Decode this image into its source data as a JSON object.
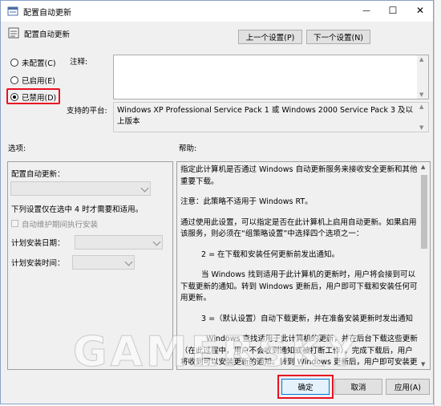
{
  "window": {
    "title": "配置自动更新",
    "header_label": "配置自动更新",
    "colors": {
      "accent": "#e81123",
      "titlebar_bg": "#ffffff",
      "dialog_bg": "#f0f0f0"
    }
  },
  "titlebar": {
    "minimize": "—",
    "maximize": "☐",
    "close": "✕"
  },
  "nav": {
    "prev_setting": "上一个设置(P)",
    "next_setting": "下一个设置(N)"
  },
  "state": {
    "options": [
      {
        "label": "未配置(C)",
        "selected": false
      },
      {
        "label": "已启用(E)",
        "selected": false
      },
      {
        "label": "已禁用(D)",
        "selected": true
      }
    ]
  },
  "comment": {
    "label": "注释:",
    "value": ""
  },
  "platform": {
    "label": "支持的平台:",
    "value": "Windows XP Professional Service Pack 1 或 Windows 2000 Service Pack 3 及以上版本"
  },
  "options_panel": {
    "label": "选项:",
    "configure_label": "配置自动更新：",
    "note": "下列设置仅在选中 4 时才需要和适用。",
    "maintenance_checkbox": "自动维护期间执行安装",
    "install_day_label": "计划安装日期：",
    "install_time_label": "计划安装时间："
  },
  "help_panel": {
    "label": "帮助:",
    "paragraphs": [
      "指定此计算机是否通过 Windows 自动更新服务来接收安全更新和其他重要下载。",
      "注意：此策略不适用于 Windows RT。",
      "通过使用此设置，可以指定是否在此计算机上启用自动更新。如果启用该服务，则必须在“组策略设置”中选择四个选项之一：",
      "2 = 在下载和安装任何更新前发出通知。",
      "当 Windows 找到适用于此计算机的更新时，用户将会接到可以下载更新的通知。转到 Windows 更新后，用户即可下载和安装任何可用更新。",
      "3 =（默认设置）自动下载更新，并在准备安装更新时发出通知",
      "Windows 查找适用于此计算机的更新，并在后台下载这些更新（在此过程中，用户不会收到通知或被打断工作）。完成下载后，用户将收到可以安装更新的通知。转到 Windows 更新后，用户即可安装更新。"
    ]
  },
  "footer": {
    "ok": "确定",
    "cancel": "取消",
    "apply": "应用(A)"
  },
  "watermark": "GAMERSKY"
}
